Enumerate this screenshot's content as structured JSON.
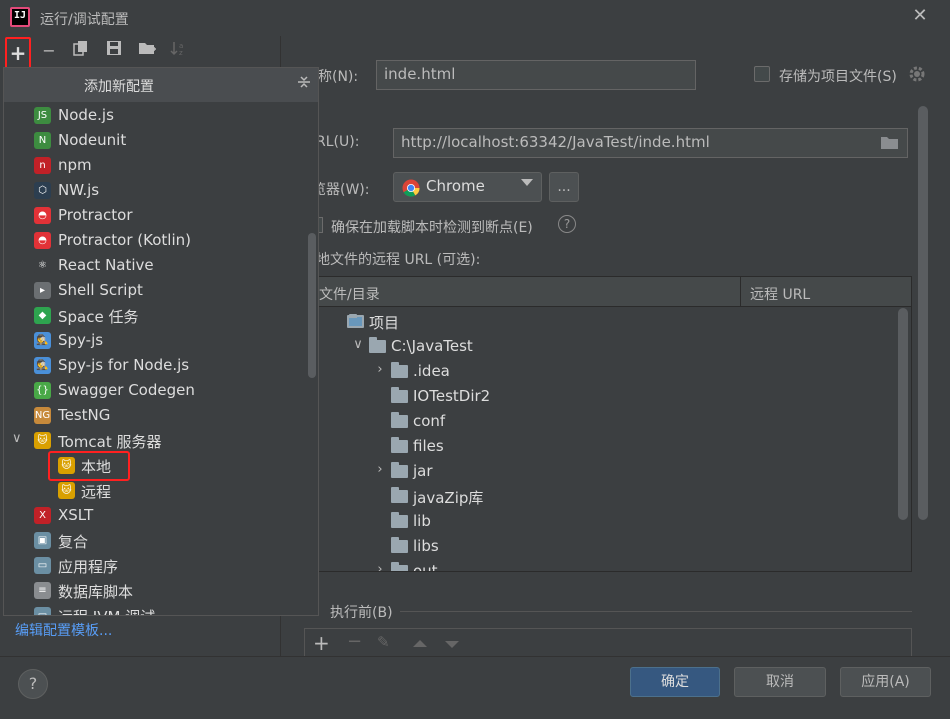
{
  "window": {
    "title": "运行/调试配置",
    "close_glyph": "✕"
  },
  "toolbar": {
    "add": "+",
    "remove": "−",
    "copy": "⧉",
    "save": "💾",
    "folder": "📁",
    "sort": "↓ᵃ"
  },
  "popup": {
    "title": "添加新配置",
    "items": [
      {
        "label": "Node.js",
        "icon": "nodejs-icon",
        "color": "#3d8c40",
        "glyph": "JS"
      },
      {
        "label": "Nodeunit",
        "icon": "nodeunit-icon",
        "color": "#3d8c40",
        "glyph": "N"
      },
      {
        "label": "npm",
        "icon": "npm-icon",
        "color": "#c12127",
        "glyph": "n"
      },
      {
        "label": "NW.js",
        "icon": "nwjs-icon",
        "color": "#2c3e50",
        "glyph": "⬡"
      },
      {
        "label": "Protractor",
        "icon": "protractor-icon",
        "color": "#e23237",
        "glyph": "◓"
      },
      {
        "label": "Protractor (Kotlin)",
        "icon": "protractor-kotlin-icon",
        "color": "#e23237",
        "glyph": "◓"
      },
      {
        "label": "React Native",
        "icon": "react-icon",
        "color": "#3c3f41",
        "glyph": "⚛"
      },
      {
        "label": "Shell Script",
        "icon": "shell-icon",
        "color": "#6b6f72",
        "glyph": "▸"
      },
      {
        "label": "Space 任务",
        "icon": "space-icon",
        "color": "#2ea44f",
        "glyph": "◆"
      },
      {
        "label": "Spy-js",
        "icon": "spyjs-icon",
        "color": "#4a90d9",
        "glyph": "🕵"
      },
      {
        "label": "Spy-js for Node.js",
        "icon": "spyjs-node-icon",
        "color": "#4a90d9",
        "glyph": "🕵"
      },
      {
        "label": "Swagger Codegen",
        "icon": "swagger-icon",
        "color": "#49a847",
        "glyph": "{}"
      },
      {
        "label": "TestNG",
        "icon": "testng-icon",
        "color": "#c78a3b",
        "glyph": "NG"
      },
      {
        "label": "Tomcat 服务器",
        "icon": "tomcat-icon",
        "color": "#d9a000",
        "glyph": "🐱"
      },
      {
        "label": "本地",
        "icon": "tomcat-local-icon",
        "color": "#d9a000",
        "glyph": "🐱"
      },
      {
        "label": "远程",
        "icon": "tomcat-remote-icon",
        "color": "#d9a000",
        "glyph": "🐱"
      },
      {
        "label": "XSLT",
        "icon": "xslt-icon",
        "color": "#c12127",
        "glyph": "X"
      },
      {
        "label": "复合",
        "icon": "compound-icon",
        "color": "#6b8fa3",
        "glyph": "▣"
      },
      {
        "label": "应用程序",
        "icon": "application-icon",
        "color": "#6b8fa3",
        "glyph": "▭"
      },
      {
        "label": "数据库脚本",
        "icon": "database-icon",
        "color": "#8a8d90",
        "glyph": "≡"
      },
      {
        "label": "远程 JVM 调试",
        "icon": "remote-jvm-icon",
        "color": "#6b8fa3",
        "glyph": "▭"
      }
    ]
  },
  "edit_templates": "编辑配置模板...",
  "form": {
    "name_label": "称(N):",
    "name_value": "inde.html",
    "store_label": "存储为项目文件(S)",
    "url_label": "RL(U):",
    "url_value": "http://localhost:63342/JavaTest/inde.html",
    "browser_label": "览器(W):",
    "browser_value": "Chrome",
    "browser_more": "...",
    "ensure_label": "确保在加载脚本时检测到断点(E)",
    "remote_urls_label": "地文件的远程 URL (可选):",
    "col_file": "文件/目录",
    "col_remote": "远程 URL",
    "before_label": "执行前(B)"
  },
  "tree": [
    {
      "label": "项目",
      "expand": "",
      "level": 0,
      "kind": "project"
    },
    {
      "label": "C:\\JavaTest",
      "expand": "∨",
      "level": 1,
      "kind": "folder"
    },
    {
      "label": ".idea",
      "expand": "›",
      "level": 2,
      "kind": "folder"
    },
    {
      "label": "IOTestDir2",
      "expand": "",
      "level": 2,
      "kind": "folder"
    },
    {
      "label": "conf",
      "expand": "",
      "level": 2,
      "kind": "folder"
    },
    {
      "label": "files",
      "expand": "",
      "level": 2,
      "kind": "folder"
    },
    {
      "label": "jar",
      "expand": "›",
      "level": 2,
      "kind": "folder"
    },
    {
      "label": "javaZip库",
      "expand": "",
      "level": 2,
      "kind": "folder"
    },
    {
      "label": "lib",
      "expand": "",
      "level": 2,
      "kind": "folder"
    },
    {
      "label": "libs",
      "expand": "",
      "level": 2,
      "kind": "folder"
    },
    {
      "label": "out",
      "expand": "›",
      "level": 2,
      "kind": "folder"
    }
  ],
  "bottom": {
    "help": "?",
    "ok": "确定",
    "cancel": "取消",
    "apply": "应用(A)"
  },
  "colors": {
    "primary": "#365880",
    "highlight": "#ff2020",
    "link": "#589df6"
  }
}
